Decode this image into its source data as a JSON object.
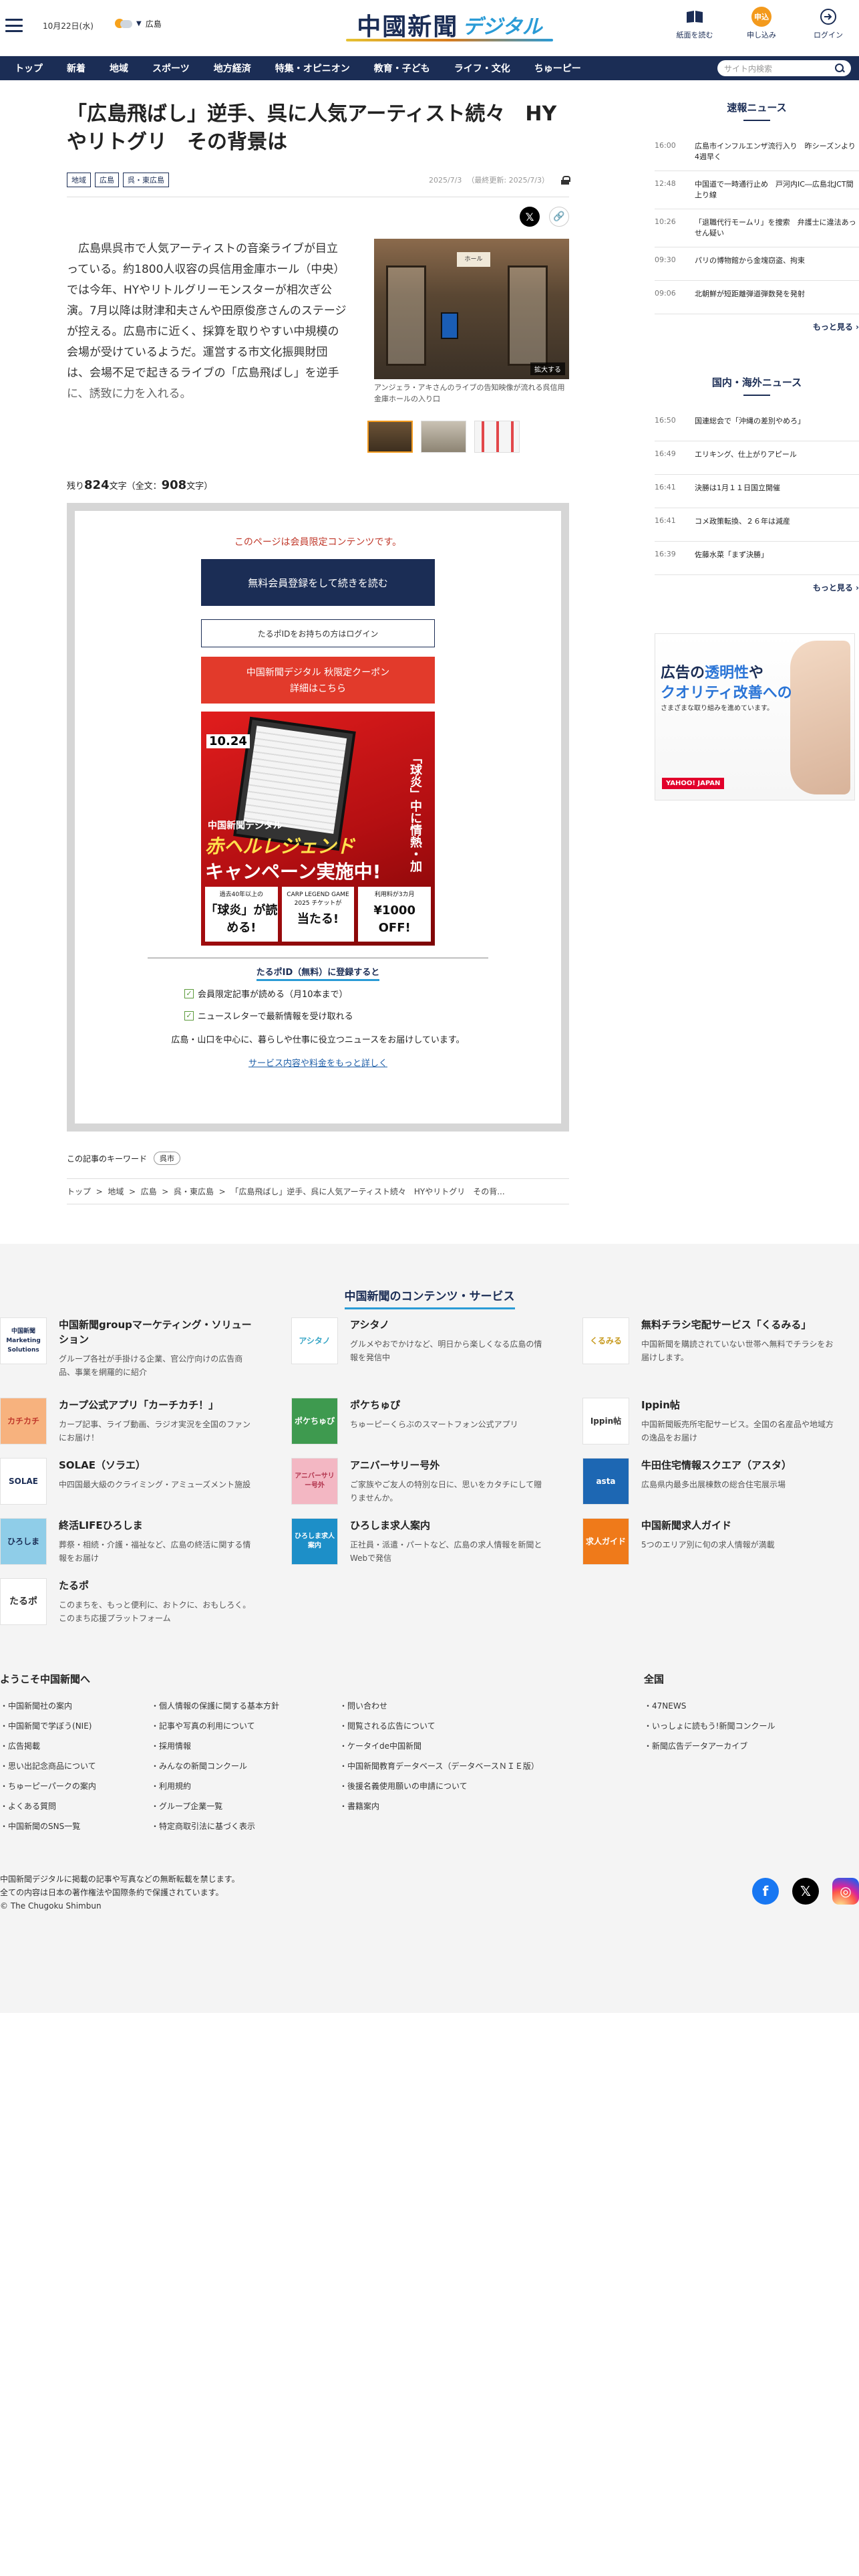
{
  "header": {
    "date": "10月22日(水)",
    "location": "広島",
    "logo_main": "中國新聞",
    "logo_sub": "デジタル",
    "buttons": [
      {
        "label": "紙面を読む",
        "icon": "book-icon"
      },
      {
        "label": "申し込み",
        "icon": "subscribe-icon",
        "badge": "申込"
      },
      {
        "label": "ログイン",
        "icon": "login-icon"
      }
    ]
  },
  "nav": {
    "items": [
      "トップ",
      "新着",
      "地域",
      "スポーツ",
      "地方経済",
      "特集・オピニオン",
      "教育・子ども",
      "ライフ・文化",
      "ちゅーピー"
    ],
    "search_placeholder": "サイト内検索"
  },
  "article": {
    "headline": "「広島飛ばし」逆手、呉に人気アーティスト続々　HYやリトグリ　その背景は",
    "tags": [
      "地域",
      "広島",
      "呉・東広島"
    ],
    "date": "2025/7/3",
    "updated": "（最終更新: 2025/7/3）",
    "lead": "広島県呉市で人気アーティストの音楽ライブが目立っている。約1800人収容の呉信用金庫ホール（中央）では今年、HYやリトルグリーモンスターが相次ぎ公演。7月以降は財津和夫さんや田原俊彦さんのステージが控える。広島市に近く、採算を取りやすい中規模の会場が受けているようだ。運営する市文化振興財団は、会場不足で起きるライブの「広島飛ばし」を逆手に、誘致に力を入れる。",
    "photo_caption": "アンジェラ・アキさんのライブの告知映像が流れる呉信用金庫ホールの入り口",
    "zoom_label": "拡大する",
    "photo_sign": "ホール",
    "remain_prefix": "残り",
    "remain_count": "824",
    "remain_mid": "文字（全文：",
    "total_count": "908",
    "remain_suffix": "文字）"
  },
  "paywall": {
    "message": "このページは会員限定コンテンツです。",
    "primary_button": "無料会員登録をして続きを読む",
    "login_button": "たるポIDをお持ちの方はログイン",
    "coupon_line1": "中国新聞デジタル 秋限定クーポン",
    "coupon_line2": "詳細はこちら",
    "banner": {
      "date": "10.24",
      "kyu": "「球炎」中に情熱・加",
      "brand": "中国新聞デジタル",
      "legend": "赤ヘルレジェンド",
      "campaign": "キャンペーン実施中!",
      "boxes": [
        {
          "top": "過去40年以上の",
          "big": "「球炎」が読める!"
        },
        {
          "top": "CARP LEGEND GAME 2025 チケットが",
          "big": "当たる!"
        },
        {
          "top": "利用料が3カ月",
          "big": "¥1000 OFF!"
        }
      ]
    },
    "register_title": "たるポID（無料）に登録すると",
    "benefits": [
      "会員限定記事が読める（月10本まで）",
      "ニュースレターで最新情報を受け取れる"
    ],
    "note": "広島・山口を中心に、暮らしや仕事に役立つニュースをお届けしています。",
    "more_link": "サービス内容や料金をもっと詳しく"
  },
  "keywords": {
    "label": "この記事のキーワード",
    "items": [
      "呉市"
    ]
  },
  "breadcrumb": [
    "トップ",
    "地域",
    "広島",
    "呉・東広島",
    "「広島飛ばし」逆手、呉に人気アーティスト続々　HYやリトグリ　その背..."
  ],
  "sidebar": {
    "flash_title": "速報ニュース",
    "flash": [
      {
        "time": "16:00",
        "headline": "広島市インフルエンザ流行入り　昨シーズンより4週早く"
      },
      {
        "time": "12:48",
        "headline": "中国道で一時通行止め　戸河内IC―広島北JCT間上り線"
      },
      {
        "time": "10:26",
        "headline": "「退職代行モームリ」を捜索　弁護士に違法あっせん疑い"
      },
      {
        "time": "09:30",
        "headline": "パリの博物館から金塊窃盗、拘束"
      },
      {
        "time": "09:06",
        "headline": "北朝鮮が短距離弾道弾数発を発射"
      }
    ],
    "more": "もっと見る",
    "world_title": "国内・海外ニュース",
    "world": [
      {
        "time": "16:50",
        "headline": "国連総会で「沖縄の差別やめろ」"
      },
      {
        "time": "16:49",
        "headline": "エリキング、仕上がりアピール"
      },
      {
        "time": "16:41",
        "headline": "決勝は1月１１日国立開催"
      },
      {
        "time": "16:41",
        "headline": "コメ政策転換、２６年は減産"
      },
      {
        "time": "16:39",
        "headline": "佐藤水菜「まず決勝」"
      }
    ],
    "ad": {
      "line1a": "広告の",
      "line1b": "透明性",
      "line1c": "や",
      "line2": "クオリティ改善への",
      "line3": "さまざまな取り組みを進めています。",
      "logo": "YAHOO! JAPAN"
    }
  },
  "contents": {
    "title": "中国新聞のコンテンツ・サービス",
    "items": [
      {
        "icon_text": "中国新聞 Marketing Solutions",
        "name": "中国新聞groupマーケティング・ソリューション",
        "desc": "グループ各社が手掛ける企業、官公庁向けの広告商品、事業を網羅的に紹介"
      },
      {
        "icon_text": "アシタノ",
        "name": "アシタノ",
        "desc": "グルメやおでかけなど、明日から楽しくなる広島の情報を発信中"
      },
      {
        "icon_text": "くるみる",
        "name": "無料チラシ宅配サービス「くるみる」",
        "desc": "中国新聞を購読されていない世帯へ無料でチラシをお届けします。"
      },
      {
        "icon_text": "カチカチ",
        "name": "カープ公式アプリ「カーチカチ！」",
        "desc": "カープ記事、ライブ動画、ラジオ実況を全国のファンにお届け！"
      },
      {
        "icon_text": "ポケちゅぴ",
        "name": "ポケちゅぴ",
        "desc": "ちゅーピーくらぶのスマートフォン公式アプリ"
      },
      {
        "icon_text": "Ippin帖",
        "name": "Ippin帖",
        "desc": "中国新聞販売所宅配サービス。全国の名産品や地域方の逸品をお届け"
      },
      {
        "icon_text": "SOLAE",
        "name": "SOLAE（ソラエ）",
        "desc": "中四国最大級のクライミング・アミューズメント施設"
      },
      {
        "icon_text": "アニバーサリー号外",
        "name": "アニバーサリー号外",
        "desc": "ご家族やご友人の特別な日に、思いをカタチにして贈りませんか。"
      },
      {
        "icon_text": "asta",
        "name": "牛田住宅情報スクエア（アスタ）",
        "desc": "広島県内最多出展棟数の総合住宅展示場"
      },
      {
        "icon_text": "ひろしま",
        "name": "終活LIFEひろしま",
        "desc": "葬祭・相続・介護・福祉など、広島の終活に関する情報をお届け"
      },
      {
        "icon_text": "ひろしま求人案内",
        "name": "ひろしま求人案内",
        "desc": "正社員・派遣・パートなど、広島の求人情報を新聞とWebで発信"
      },
      {
        "icon_text": "求人ガイド",
        "name": "中国新聞求人ガイド",
        "desc": "5つのエリア別に旬の求人情報が満載"
      },
      {
        "icon_text": "たるポ",
        "name": "たるポ",
        "desc": "このまちを、もっと便利に、おトクに、おもしろく。このまち応援プラットフォーム"
      }
    ]
  },
  "sitemap": {
    "welcome": "ようこそ中国新聞へ",
    "national": "全国",
    "col1": [
      "中国新聞社の案内",
      "中国新聞で学ぼう(NIE)",
      "広告掲載",
      "思い出記念商品について",
      "ちゅーピーパークの案内",
      "よくある質問",
      "中国新聞のSNS一覧"
    ],
    "col2": [
      "個人情報の保護に関する基本方針",
      "記事や写真の利用について",
      "採用情報",
      "みんなの新聞コンクール",
      "利用規約",
      "グループ企業一覧",
      "特定商取引法に基づく表示"
    ],
    "col3": [
      "問い合わせ",
      "閲覧される広告について",
      "ケータイde中国新聞",
      "中国新聞教育データベース（データベースＮＩＥ版）",
      "後援名義使用願いの申請について",
      "書籍案内"
    ],
    "col4": [
      "47NEWS",
      "いっしょに読もう!新聞コンクール",
      "新聞広告データアーカイブ"
    ]
  },
  "footer": {
    "line1": "中国新聞デジタルに掲載の記事や写真などの無断転載を禁じます。",
    "line2": "全ての内容は日本の著作権法や国際条約で保護されています。",
    "copyright": "© The Chugoku Shimbun"
  }
}
